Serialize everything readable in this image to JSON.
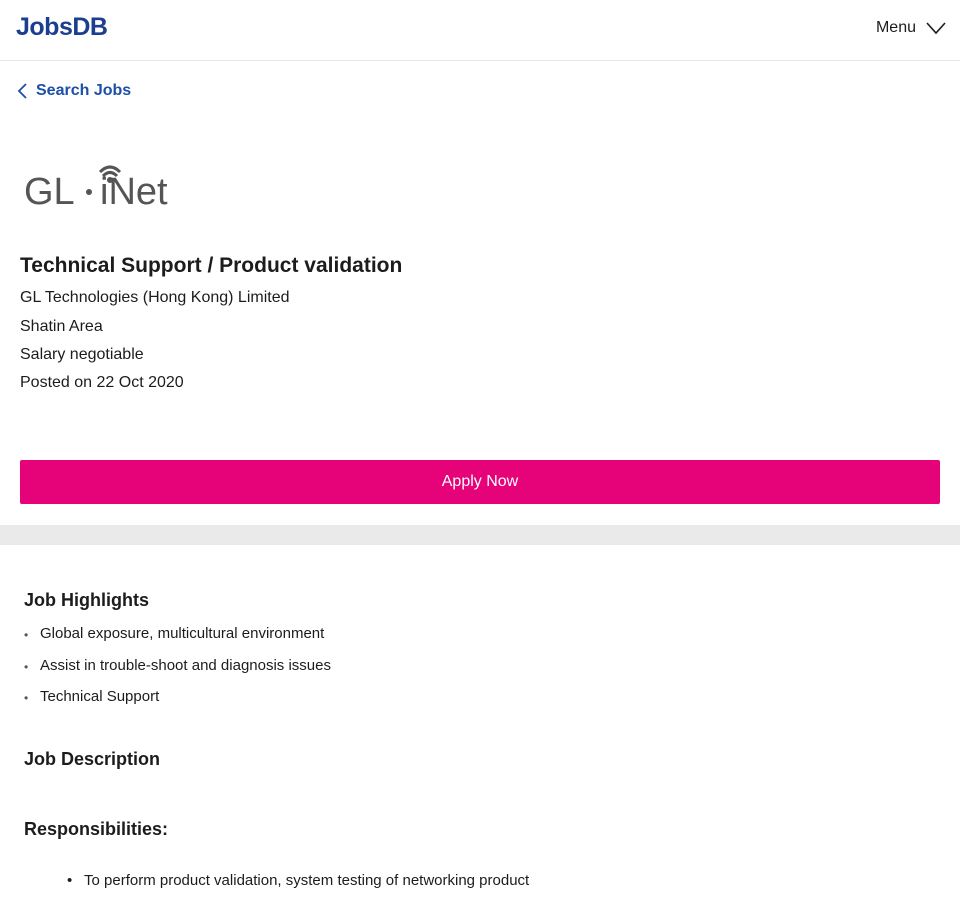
{
  "header": {
    "logo_text": "JobsDB",
    "menu_label": "Menu",
    "menu_icon": "chevron-down-icon"
  },
  "nav": {
    "back_label": "Search Jobs",
    "back_icon": "chevron-left-icon"
  },
  "job": {
    "company_logo_text": "GL·iNet",
    "title": "Technical Support / Product validation",
    "company": "GL Technologies (Hong Kong) Limited",
    "location": "Shatin Area",
    "salary": "Salary negotiable",
    "posted": "Posted on 22 Oct 2020"
  },
  "actions": {
    "apply_label": "Apply Now"
  },
  "highlights": {
    "title": "Job Highlights",
    "items": [
      "Global exposure, multicultural environment",
      "Assist in trouble-shoot and diagnosis issues",
      "Technical Support"
    ]
  },
  "description": {
    "title": "Job Description",
    "responsibilities_title": "Responsibilities:",
    "responsibilities": [
      "To perform product validation, system testing of networking product"
    ]
  },
  "colors": {
    "brand_blue": "#1c3e8e",
    "link_blue": "#1c4fa8",
    "apply_pink": "#e60278",
    "band_grey": "#eaeaea"
  }
}
